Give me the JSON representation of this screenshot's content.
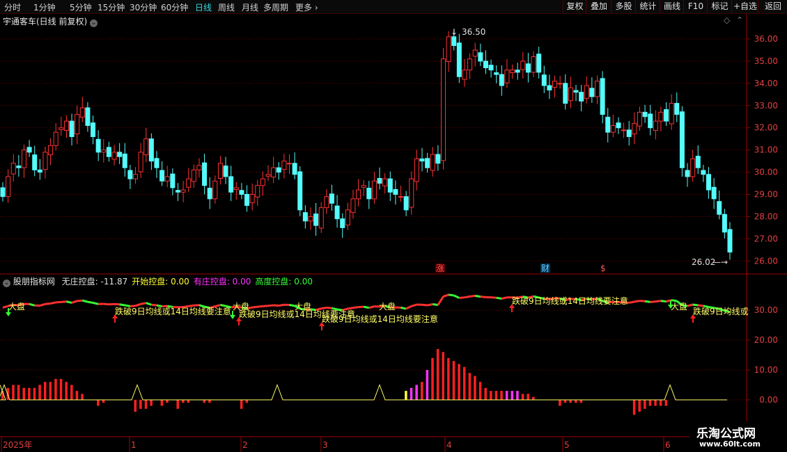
{
  "periods": [
    "分时",
    "1分钟",
    "5分钟",
    "15分钟",
    "30分钟",
    "60分钟",
    "日线",
    "周线",
    "月线",
    "多周期",
    "更多"
  ],
  "active_period": "日线",
  "toolbar": [
    "复权",
    "叠加",
    "多股",
    "统计",
    "画线",
    "F10",
    "标记",
    "+自选",
    "返回"
  ],
  "stock": {
    "title": "宇通客车(日线 前复权)"
  },
  "price_axis": [
    "36.00",
    "35.00",
    "34.00",
    "33.00",
    "32.00",
    "31.00",
    "30.00",
    "29.00",
    "28.00",
    "27.00",
    "26.00"
  ],
  "high_label": "36.50",
  "low_label": "26.02",
  "event_marks": [
    "涨",
    "财",
    "$"
  ],
  "indicator": {
    "name": "股朋指标网",
    "items": [
      {
        "label": "无庄控盘:",
        "value": "-11.87",
        "color": "#e0e0e0"
      },
      {
        "label": "开始控盘:",
        "value": "0.00",
        "color": "#ffff33"
      },
      {
        "label": "有庄控盘:",
        "value": "0.00",
        "color": "#ff33ff"
      },
      {
        "label": "高度控盘:",
        "value": "0.00",
        "color": "#33ff33"
      }
    ]
  },
  "ind_axis": [
    "30.00",
    "20.00",
    "10.00",
    "0.00"
  ],
  "big_label": "大盘",
  "warn_label": "跌破9日均线或14日均线要注意",
  "warn_label_short": "跌破9日均线或",
  "dates": [
    "2025年",
    "1",
    "2",
    "3",
    "4",
    "5",
    "6"
  ],
  "watermark": {
    "title": "乐淘公式网",
    "url": "www.60lt.com"
  },
  "colors": {
    "up": "#ff3232",
    "down": "#54fcfc",
    "grid": "#800000",
    "ma": "#ffffff"
  }
}
